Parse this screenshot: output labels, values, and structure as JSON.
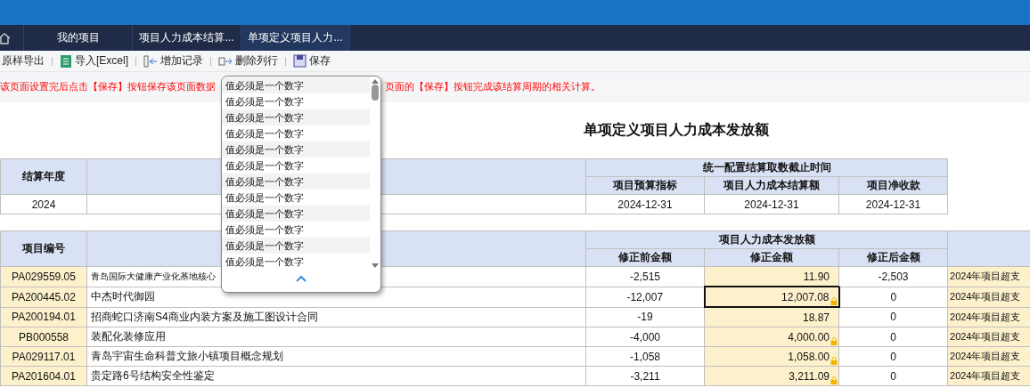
{
  "tabs": [
    {
      "label": "我的项目",
      "selected": false
    },
    {
      "label": "项目人力成本结算...",
      "selected": false
    },
    {
      "label": "单项定义项目人力...",
      "selected": true
    }
  ],
  "toolbar": [
    {
      "kind": "export",
      "label": "原样导出"
    },
    {
      "kind": "excel",
      "label": "导入[Excel]"
    },
    {
      "kind": "add",
      "label": "增加记录"
    },
    {
      "kind": "delete",
      "label": "删除列行"
    },
    {
      "kind": "save",
      "label": "保存"
    }
  ],
  "notice": {
    "left": "该页面设置完后点击【保存】按钮保存该页面数据",
    "right": "页面的【保存】按钮完成该结算周期的相关计算。"
  },
  "title": "单项定义项目人力成本发放额",
  "settlement_table": {
    "first_column": "结算年度",
    "group": "统一配置结算取数截止时间",
    "sub_columns": [
      "项目预算指标",
      "项目人力成本结算额",
      "项目净收款"
    ],
    "rows": [
      {
        "year": "2024",
        "dates": [
          "2024-12-31",
          "2024-12-31",
          "2024-12-31"
        ]
      }
    ]
  },
  "payout_table": {
    "first_column": "项目编号",
    "group": "项目人力成本发放额",
    "sub_columns": [
      "修正前金额",
      "修正金额",
      "修正后金额"
    ],
    "rows": [
      {
        "code": "PA029559.05",
        "name": "青岛国际大健康产业化基地核心",
        "before": "-2,515",
        "adjust": "11.90",
        "after": "-2,503",
        "column_7": "2024年项目超支",
        "locked": false,
        "selected": false
      },
      {
        "code": "PA200445.02",
        "name": "中杰时代御园",
        "before": "-12,007",
        "adjust": "12,007.08",
        "after": "0",
        "column_7": "2024年项目超支",
        "locked": true,
        "selected": true
      },
      {
        "code": "PA200194.01",
        "name": "招商蛇口济南S4商业内装方案及施工图设计合同",
        "before": "-19",
        "adjust": "18.87",
        "after": "0",
        "column_7": "2024年项目超支",
        "locked": false,
        "selected": false
      },
      {
        "code": "PB000558",
        "name": "装配化装修应用",
        "before": "-4,000",
        "adjust": "4,000.00",
        "after": "0",
        "column_7": "2024年项目超支",
        "locked": true,
        "selected": false
      },
      {
        "code": "PA029117.01",
        "name": "青岛宇宙生命科普文旅小镇项目概念规划",
        "before": "-1,058",
        "adjust": "1,058.00",
        "after": "0",
        "column_7": "2024年项目超支",
        "locked": true,
        "selected": false
      },
      {
        "code": "PA201604.01",
        "name": "贵定路6号结构安全性鉴定",
        "before": "-3,211",
        "adjust": "3,211.09",
        "after": "0",
        "column_7": "2024年项目超支",
        "locked": true,
        "selected": false
      }
    ]
  },
  "dropdown": {
    "items": [
      "值必须是一个数字",
      "值必须是一个数字",
      "值必须是一个数字",
      "值必须是一个数字",
      "值必须是一个数字",
      "值必须是一个数字",
      "值必须是一个数字",
      "值必须是一个数字",
      "值必须是一个数字",
      "值必须是一个数字",
      "值必须是一个数字",
      "值必须是一个数字"
    ]
  }
}
